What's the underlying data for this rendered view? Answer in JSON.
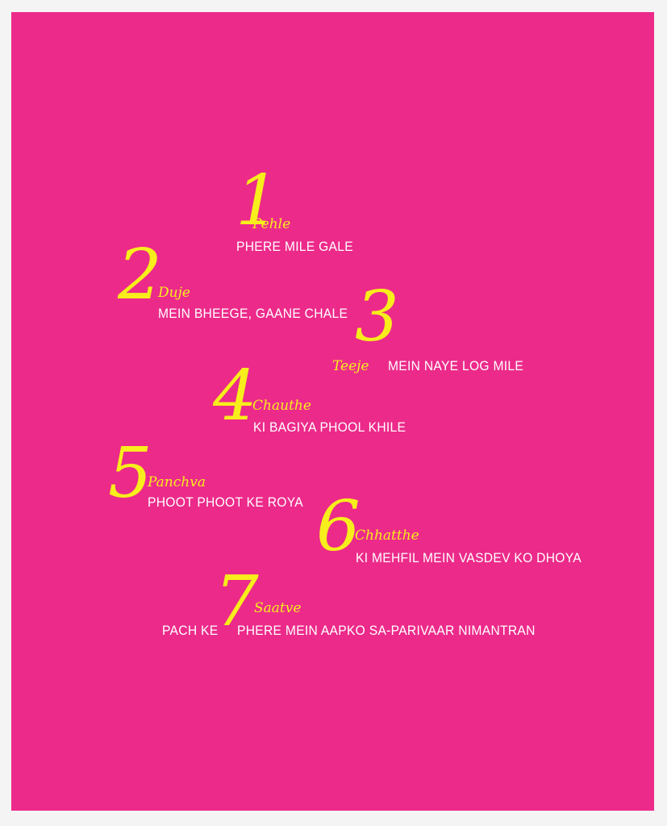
{
  "colors": {
    "background": "#ec2a8a",
    "numeral": "#f7ee1c",
    "text": "#ffffff",
    "frame": "#f4f4f4"
  },
  "steps": [
    {
      "number": "1",
      "word": "Pehle",
      "text": "PHERE MILE GALE"
    },
    {
      "number": "2",
      "word": "Duje",
      "text": "MEIN BHEEGE, GAANE CHALE"
    },
    {
      "number": "3",
      "word": "Teeje",
      "text": "MEIN NAYE LOG MILE"
    },
    {
      "number": "4",
      "word": "Chauthe",
      "text": "KI BAGIYA PHOOL KHILE"
    },
    {
      "number": "5",
      "word": "Panchva",
      "text": "PHOOT PHOOT KE ROYA"
    },
    {
      "number": "6",
      "word": "Chhatthe",
      "text": "KI MEHFIL MEIN VASDEV KO DHOYA"
    },
    {
      "number": "7",
      "word": "Saatve",
      "prefix": "PACH KE",
      "text": "PHERE MEIN AAPKO SA-PARIVAAR NIMANTRAN"
    }
  ]
}
